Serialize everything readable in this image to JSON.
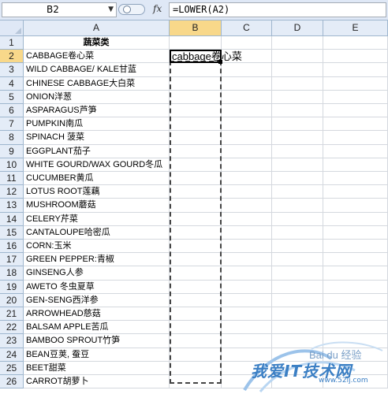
{
  "formula_bar": {
    "name_box": "B2",
    "fx": "fx",
    "formula": "=LOWER(A2)"
  },
  "columns": [
    "A",
    "B",
    "C",
    "D",
    "E"
  ],
  "rows": [
    "1",
    "2",
    "3",
    "4",
    "5",
    "6",
    "7",
    "8",
    "9",
    "10",
    "11",
    "12",
    "13",
    "14",
    "15",
    "16",
    "17",
    "18",
    "19",
    "20",
    "21",
    "22",
    "23",
    "24",
    "25",
    "26"
  ],
  "selected": {
    "column": "B",
    "row": "2"
  },
  "cells": {
    "a1": "蔬菜类",
    "b2": "cabbage卷心菜",
    "column_a": [
      "CABBAGE卷心菜",
      "WILD CABBAGE/ KALE甘蓝",
      "CHINESE CABBAGE大白菜",
      "ONION洋葱",
      "ASPARAGUS芦笋",
      "PUMPKIN南瓜",
      "SPINACH 菠菜",
      "EGGPLANT茄子",
      "WHITE GOURD/WAX GOURD冬瓜",
      "CUCUMBER黄瓜",
      "LOTUS ROOT莲藕",
      "MUSHROOM蘑菇",
      "CELERY芹菜",
      "CANTALOUPE哈密瓜",
      "CORN:玉米",
      "GREEN PEPPER:青椒",
      "GINSENG人参",
      "AWETO 冬虫夏草",
      "GEN-SENG西洋参",
      "ARROWHEAD慈菇",
      "BALSAM APPLE苦瓜",
      "BAMBOO SPROUT竹笋",
      "BEAN豆荚, 蚕豆",
      "BEET甜菜",
      "CARROT胡萝卜"
    ]
  },
  "watermark": {
    "text": "我爱IT技术网",
    "url": "www.52ij.com",
    "brand": "Bai du 经验"
  }
}
